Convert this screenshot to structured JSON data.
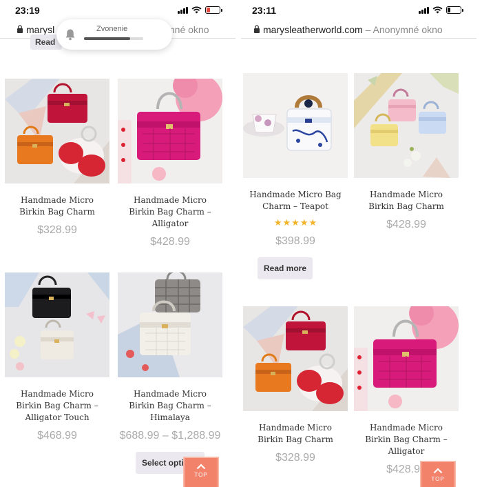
{
  "left_screen": {
    "status": {
      "time": "23:19"
    },
    "url_bar": {
      "url": "marysl",
      "partial_mode": "mné okno"
    },
    "prev_button_label": "Read",
    "toast": {
      "label": "Zvonenie",
      "level": 0.78
    },
    "products": [
      {
        "title": "Handmade Micro Birkin Bag Charm",
        "price": "$328.99"
      },
      {
        "title": "Handmade Micro Birkin Bag Charm – Alligator",
        "price": "$428.99"
      },
      {
        "title": "Handmade Micro Birkin Bag Charm – Alligator Touch",
        "price": "$468.99"
      },
      {
        "title": "Handmade Micro Birkin Bag Charm – Himalaya",
        "price": "$688.99 – $1,288.99",
        "button": "Select options"
      }
    ],
    "top_button": "TOP"
  },
  "right_screen": {
    "status": {
      "time": "23:11"
    },
    "url_bar": {
      "url": "marysleatherworld.com",
      "separator": "–",
      "mode": "Anonymné okno"
    },
    "products": [
      {
        "title": "Handmade Micro Bag Charm – Teapot",
        "price": "$398.99",
        "rating": 5,
        "button": "Read more"
      },
      {
        "title": "Handmade Micro Birkin Bag Charm",
        "price": "$428.99"
      },
      {
        "title": "Handmade Micro Birkin Bag Charm",
        "price": "$328.99"
      },
      {
        "title": "Handmade Micro Birkin Bag Charm – Alligator",
        "price": "$428.99"
      }
    ],
    "top_button": "TOP"
  },
  "colors": {
    "accent": "#f2826a",
    "star": "#f0b429",
    "price": "#aaaaaa",
    "button_bg": "#ebe9ef",
    "battery_low": "#e5463d"
  },
  "icons": [
    "lock-icon",
    "bell-icon",
    "signal-icon",
    "wifi-icon",
    "battery-icon",
    "chevron-up-icon",
    "star-icon"
  ]
}
